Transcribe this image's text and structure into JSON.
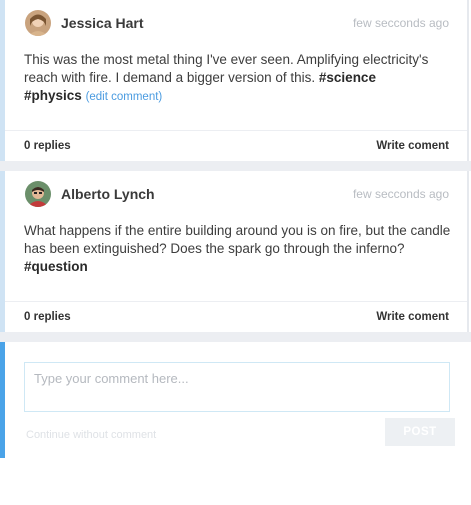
{
  "comments": [
    {
      "author": "Jessica Hart",
      "time": "few secconds ago",
      "text_before": "This was the most metal thing I've ever seen. Amplifying electricity's reach with fire. I demand a bigger version of this. ",
      "tag1": "#science",
      "tag2": "#physics",
      "edit_label": "(edit comment)",
      "replies": "0 replies",
      "write": "Write coment"
    },
    {
      "author": "Alberto Lynch",
      "time": "few secconds ago",
      "text_before": "What happens if the entire building around you is on fire, but the candle has been extinguished? Does the spark go through the inferno? ",
      "tag1": "#question",
      "replies": "0 replies",
      "write": "Write coment"
    }
  ],
  "composer": {
    "placeholder": "Type your comment here...",
    "continue_label": "Continue without comment",
    "post_label": "POST"
  },
  "colors": {
    "accent": "#4aa3e8",
    "link": "#4a9be0",
    "card_border": "#cfe3f4"
  }
}
